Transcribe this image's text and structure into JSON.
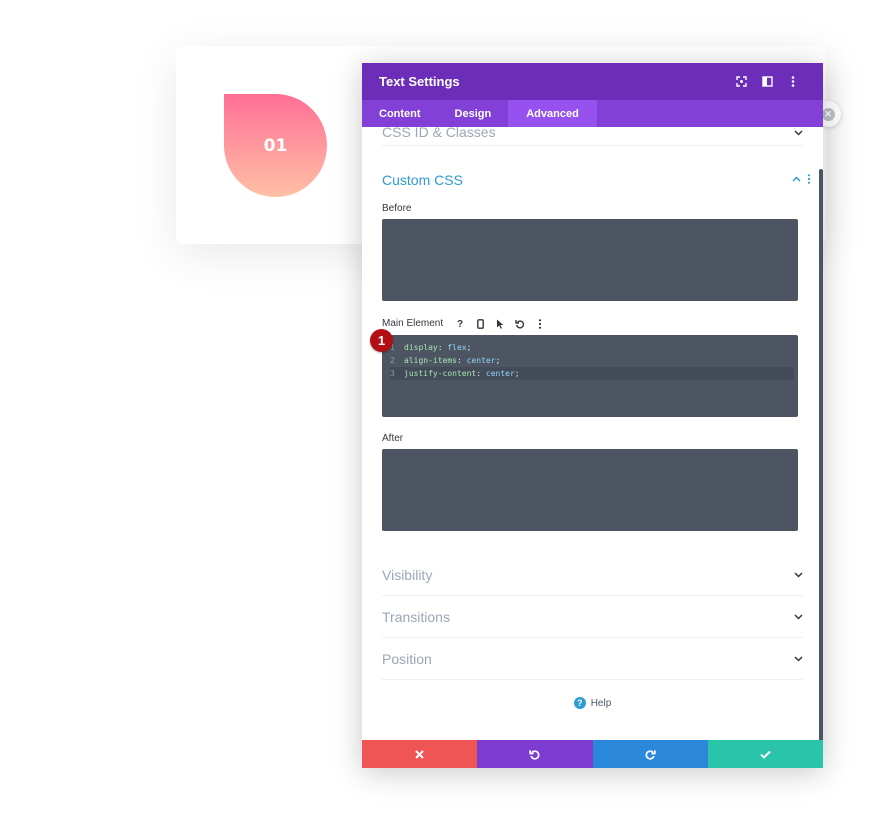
{
  "preview": {
    "number": "01"
  },
  "modal": {
    "title": "Text Settings",
    "tabs": [
      {
        "label": "Content"
      },
      {
        "label": "Design"
      },
      {
        "label": "Advanced"
      }
    ],
    "active_tab": "Advanced",
    "sections": {
      "css_id_classes": "CSS ID & Classes",
      "custom_css": "Custom CSS",
      "visibility": "Visibility",
      "transitions": "Transitions",
      "position": "Position"
    },
    "fields": {
      "before_label": "Before",
      "main_label": "Main Element",
      "after_label": "After"
    },
    "code": [
      {
        "n": "1",
        "prop": "display",
        "colon": ": ",
        "val": "flex",
        "end": ";"
      },
      {
        "n": "2",
        "prop": "align-items",
        "colon": ": ",
        "val": "center",
        "end": ";"
      },
      {
        "n": "3",
        "prop": "justify-content",
        "colon": ": ",
        "val": "center",
        "end": ";"
      }
    ],
    "badge": "1",
    "help": "Help",
    "colors": {
      "header": "#6c2eb9",
      "tabs": "#8240d6",
      "accent": "#2e9bd3",
      "cancel": "#ef5555",
      "undo": "#7e3bd0",
      "redo": "#2b87da",
      "save": "#29c4a9"
    }
  }
}
